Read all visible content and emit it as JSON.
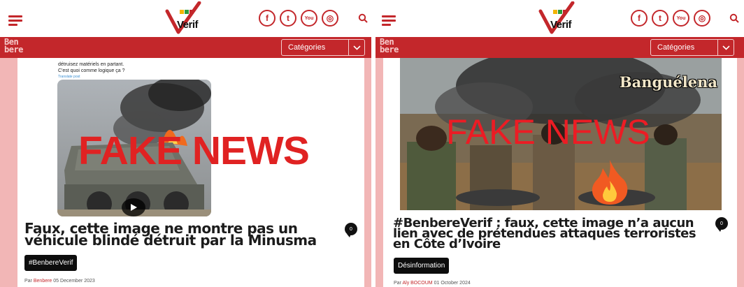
{
  "colors": {
    "accent": "#c3272b",
    "page_bg": "#f2b6b6",
    "fake_red": "#e02222",
    "tag_bg": "#0d0d0d"
  },
  "header": {
    "logo_text": "Verif",
    "logo_mini": "Ben bere",
    "brand": [
      "Ben",
      "bere"
    ],
    "social_icons": [
      "facebook-icon",
      "twitter-icon",
      "youtube-icon",
      "instagram-icon"
    ],
    "social_glyphs": [
      "f",
      "t",
      "You",
      "◎"
    ],
    "categories_label": "Catégories"
  },
  "articles": [
    {
      "tweet_text": [
        "détruisez matériels en partant.",
        "C'est quoi comme logique ça ?"
      ],
      "translate_label": "Translate post",
      "overlay": "FAKE NEWS",
      "title": "Faux, cette image ne montre pas un véhicule blindé détruit par la Minusma",
      "comments": "0",
      "tag": "#BenbereVerif",
      "by_prefix": "Par",
      "author": "Benbere",
      "date": "05 December 2023"
    },
    {
      "image_caption": "Banguélena",
      "overlay": "FAKE NEWS",
      "title": "#BenbereVerif : faux, cette image n’a aucun lien avec de prétendues attaques terroristes en Côte d’Ivoire",
      "comments": "0",
      "tag": "Désinformation",
      "by_prefix": "Par",
      "author": "Aly BOCOUM",
      "date": "01 October 2024"
    }
  ]
}
